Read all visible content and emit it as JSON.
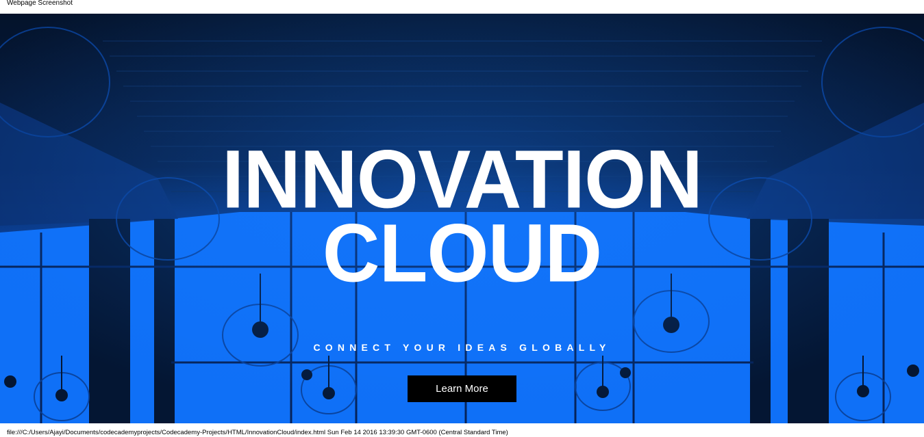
{
  "header": {
    "caption": "Webpage Screenshot"
  },
  "hero": {
    "title_line1": "INNOVATION",
    "title_line2": "CLOUD",
    "tagline": "CONNECT YOUR IDEAS GLOBALLY",
    "button_label": "Learn More"
  },
  "footer": {
    "file_info": "file:///C:/Users/Ajayi/Documents/codecademyprojects/Codecademy-Projects/HTML/InnovationCloud/index.html Sun Feb 14 2016 13:39:30 GMT-0600 (Central Standard Time)"
  },
  "colors": {
    "hero_blue": "#0d6ef5",
    "hero_dark": "#061a3a",
    "button_bg": "#000000",
    "text": "#ffffff"
  }
}
